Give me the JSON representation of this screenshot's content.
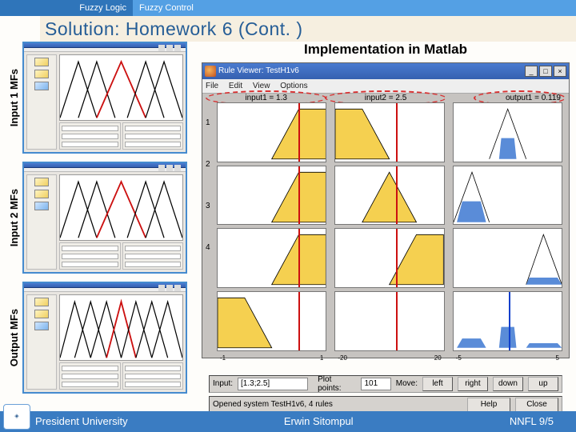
{
  "topbar": {
    "left": "Fuzzy Logic",
    "right": "Fuzzy Control"
  },
  "title": "Solution: Homework 6 (Cont. )",
  "left_panels": {
    "labels": [
      "Input 1 MFs",
      "Input 2 MFs",
      "Output MFs"
    ]
  },
  "impl_title": "Implementation in Matlab",
  "rule_viewer": {
    "window_title": "Rule Viewer: TestH1v6",
    "menu": [
      "File",
      "Edit",
      "View",
      "Options"
    ],
    "header": {
      "in1": "input1 = 1.3",
      "in2": "input2 = 2.5",
      "out": "output1 = 0.119"
    },
    "rows": [
      "1",
      "2",
      "3",
      "4"
    ],
    "xaxis": {
      "in1": [
        "-1",
        "1"
      ],
      "in2": [
        "-20",
        "20"
      ],
      "out": [
        "-5",
        "5"
      ]
    },
    "form": {
      "input_label": "Input:",
      "input_value": "[1.3;2.5]",
      "plot_label": "Plot points:",
      "plot_value": "101",
      "move_label": "Move:",
      "buttons": [
        "left",
        "right",
        "down",
        "up"
      ],
      "status": "Opened system TestH1v6, 4 rules",
      "help": "Help",
      "close": "Close"
    },
    "caption": "Rule Viewer"
  },
  "footer": {
    "left": "President University",
    "center": "Erwin Sitompul",
    "right": "NNFL 9/5"
  }
}
